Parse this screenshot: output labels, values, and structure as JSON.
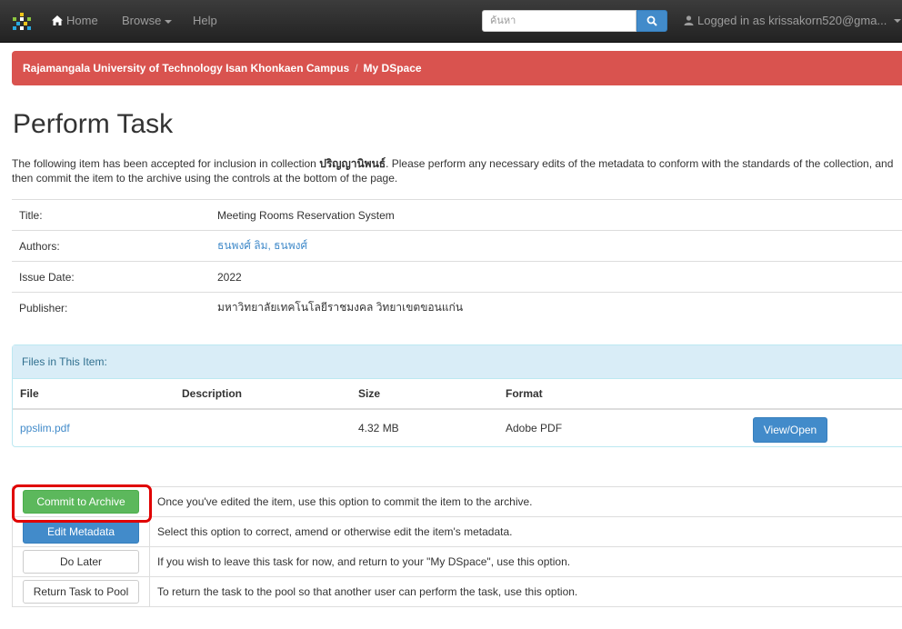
{
  "navbar": {
    "home_label": "Home",
    "browse_label": "Browse",
    "help_label": "Help",
    "search_placeholder": "ค้นหา",
    "user_label": "Logged in as krissakorn520@gma..."
  },
  "trail": {
    "campus": "Rajamangala University of Technology Isan Khonkaen Campus",
    "separator": "/",
    "current": "My DSpace"
  },
  "page": {
    "title": "Perform Task",
    "intro_prefix": "The following item has been accepted for inclusion in collection ",
    "collection": "ปริญญานิพนธ์",
    "intro_suffix": ". Please perform any necessary edits of the metadata to conform with the standards of the collection, and then commit the item to the archive using the controls at the bottom of the page."
  },
  "metadata": [
    {
      "label": "Title:",
      "value": "Meeting Rooms Reservation System",
      "link": false
    },
    {
      "label": "Authors:",
      "value": "ธนพงศ์ ลิม, ธนพงศ์",
      "link": true
    },
    {
      "label": "Issue Date:",
      "value": "2022",
      "link": false
    },
    {
      "label": "Publisher:",
      "value": "มหาวิทยาลัยเทคโนโลยีราชมงคล วิทยาเขตขอนแก่น",
      "link": false
    }
  ],
  "files": {
    "heading": "Files in This Item:",
    "columns": {
      "file": "File",
      "description": "Description",
      "size": "Size",
      "format": "Format"
    },
    "rows": [
      {
        "file": "ppslim.pdf",
        "description": "",
        "size": "4.32 MB",
        "format": "Adobe PDF",
        "action": "View/Open"
      }
    ]
  },
  "actions": [
    {
      "button": "Commit to Archive",
      "style": "success",
      "description": "Once you've edited the item, use this option to commit the item to the archive."
    },
    {
      "button": "Edit Metadata",
      "style": "primary",
      "description": "Select this option to correct, amend or otherwise edit the item's metadata."
    },
    {
      "button": "Do Later",
      "style": "default",
      "description": "If you wish to leave this task for now, and return to your \"My DSpace\", use this option."
    },
    {
      "button": "Return Task to Pool",
      "style": "default",
      "description": "To return the task to the pool so that another user can perform the task, use this option."
    }
  ],
  "colors": {
    "trail_bg": "#d9534f",
    "navbar_bg": "#222222",
    "highlight": "#e00000",
    "link": "#428bca"
  }
}
